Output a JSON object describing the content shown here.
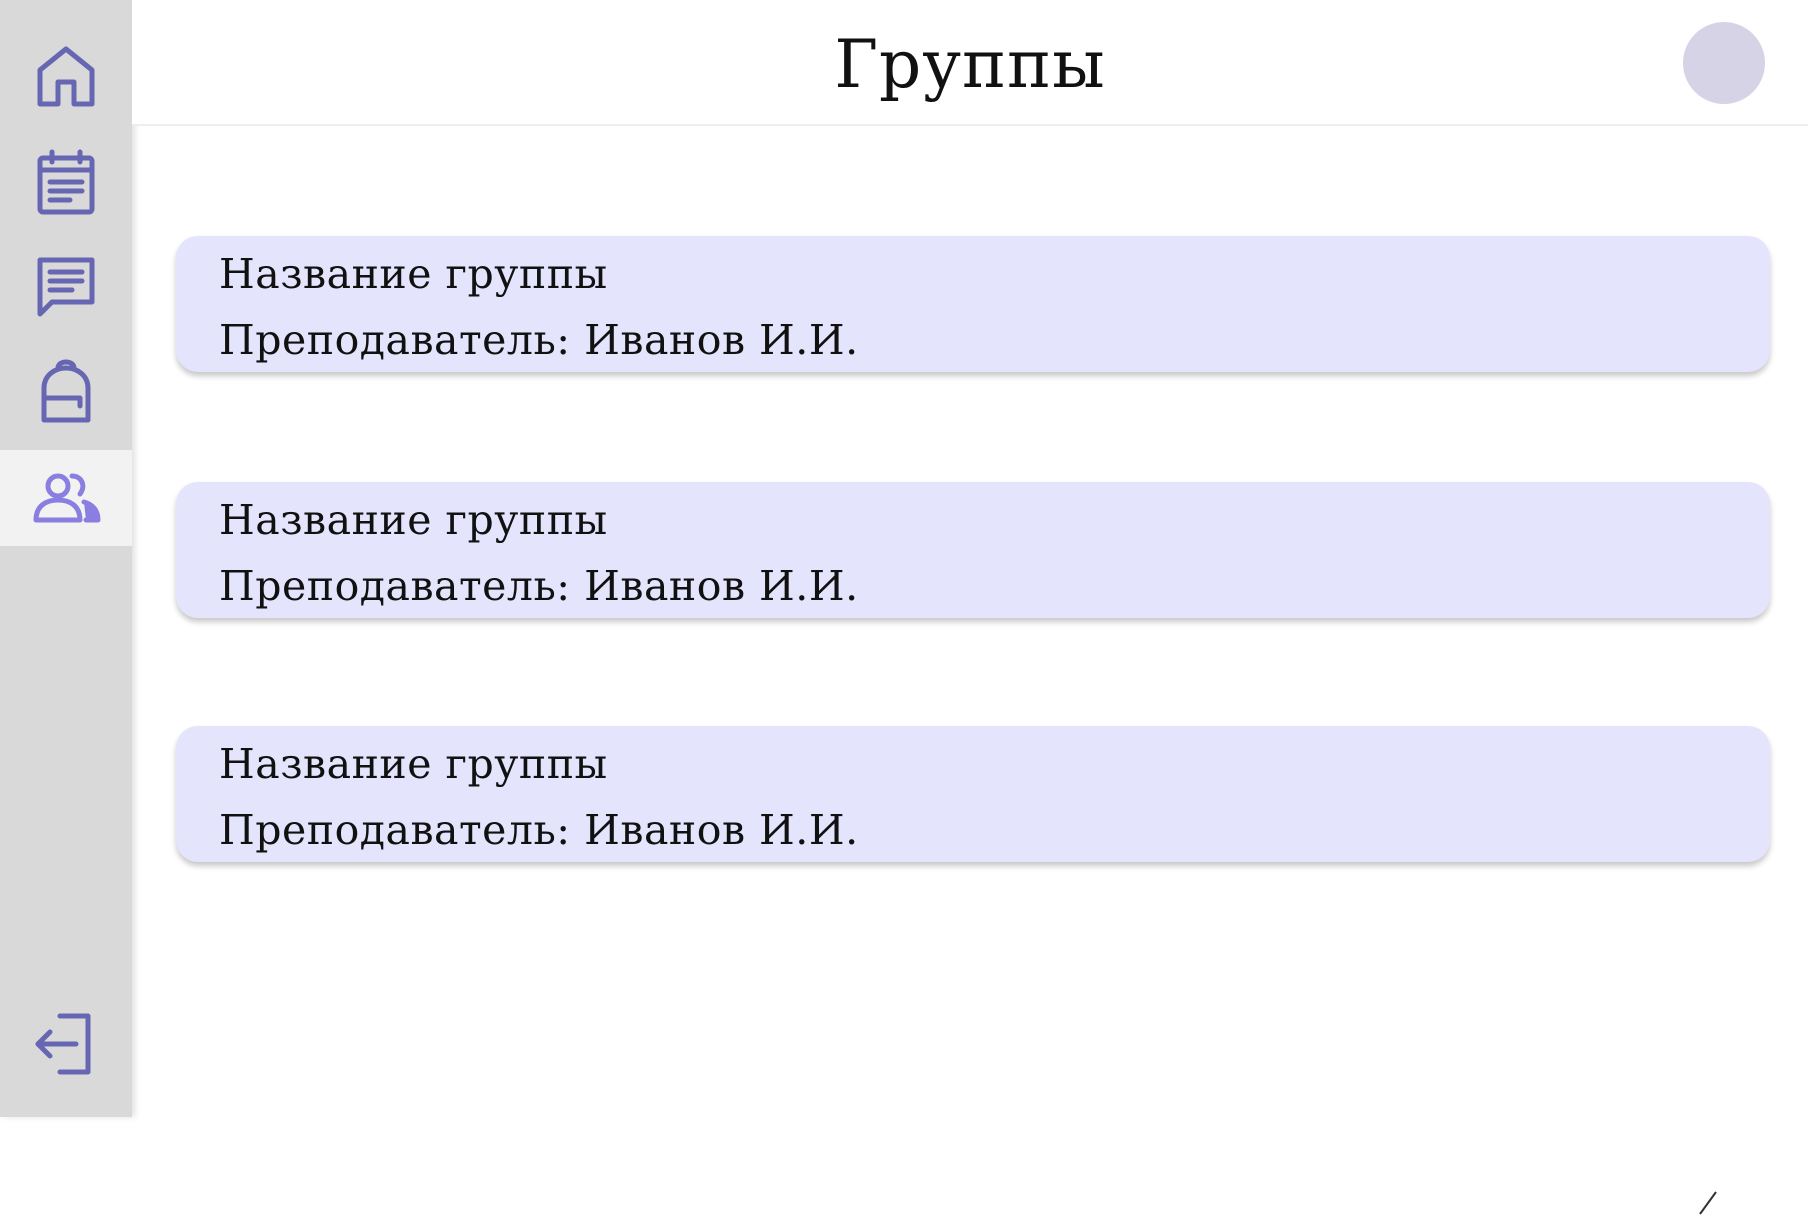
{
  "header": {
    "title": "Группы"
  },
  "colors": {
    "icon": "#6666b3",
    "icon_active": "#8a7fe0",
    "sidebar_bg": "#d9d9d9",
    "sidebar_active_bg": "#f2f2f2",
    "card_bg": "#e5e4fd",
    "avatar_bg": "#d6d3e6"
  },
  "sidebar": {
    "items": [
      {
        "icon": "home-icon"
      },
      {
        "icon": "calendar-icon"
      },
      {
        "icon": "chat-icon"
      },
      {
        "icon": "backpack-icon"
      },
      {
        "icon": "users-icon",
        "active": true
      }
    ],
    "logout_icon": "logout-icon"
  },
  "groups": [
    {
      "name": "Название группы",
      "teacher": "Преподаватель: Иванов И.И."
    },
    {
      "name": "Название группы",
      "teacher": "Преподаватель: Иванов И.И."
    },
    {
      "name": "Название группы",
      "teacher": "Преподаватель: Иванов И.И."
    }
  ]
}
